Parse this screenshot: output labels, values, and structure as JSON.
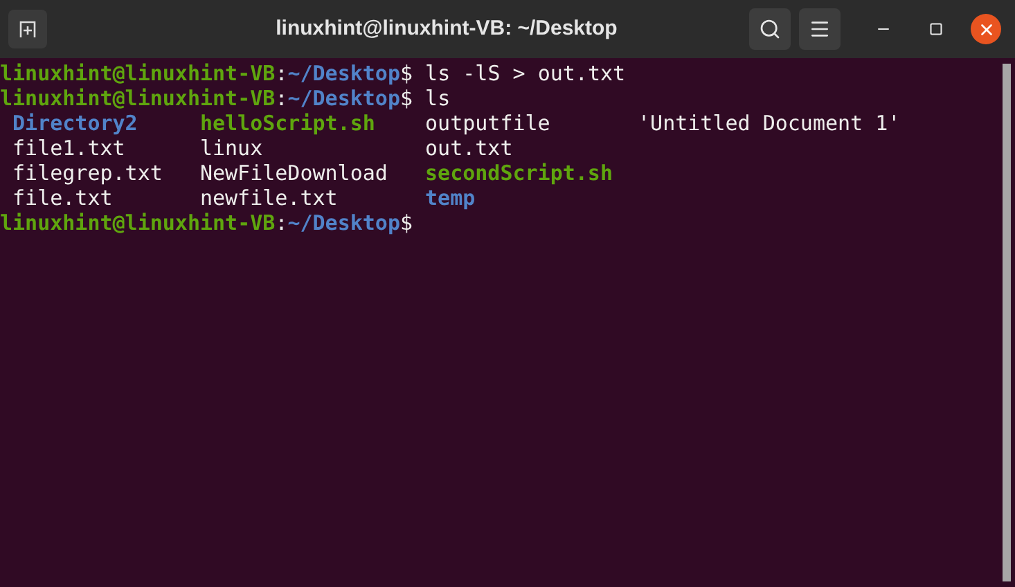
{
  "window": {
    "title": "linuxhint@linuxhint-VB: ~/Desktop"
  },
  "terminal": {
    "lines": [
      {
        "kind": "prompt",
        "user": "linuxhint@linuxhint-VB",
        "separator": ":",
        "path": "~/Desktop",
        "symbol": "$",
        "command": "ls -lS > out.txt"
      },
      {
        "kind": "prompt",
        "user": "linuxhint@linuxhint-VB",
        "separator": ":",
        "path": "~/Desktop",
        "symbol": "$",
        "command": "ls"
      },
      {
        "kind": "listing",
        "entries": [
          {
            "name": "Directory2",
            "kind": "directory"
          },
          {
            "name": "helloScript.sh",
            "kind": "executable"
          },
          {
            "name": "outputfile",
            "kind": "file"
          },
          {
            "name": "'Untitled Document 1'",
            "kind": "file"
          }
        ]
      },
      {
        "kind": "listing",
        "entries": [
          {
            "name": "file1.txt",
            "kind": "file"
          },
          {
            "name": "linux",
            "kind": "file"
          },
          {
            "name": "out.txt",
            "kind": "file"
          }
        ]
      },
      {
        "kind": "listing",
        "entries": [
          {
            "name": "filegrep.txt",
            "kind": "file"
          },
          {
            "name": "NewFileDownload",
            "kind": "file"
          },
          {
            "name": "secondScript.sh",
            "kind": "executable"
          }
        ]
      },
      {
        "kind": "listing",
        "entries": [
          {
            "name": "file.txt",
            "kind": "file"
          },
          {
            "name": "newfile.txt",
            "kind": "file"
          },
          {
            "name": "temp",
            "kind": "directory"
          }
        ]
      },
      {
        "kind": "prompt",
        "user": "linuxhint@linuxhint-VB",
        "separator": ":",
        "path": "~/Desktop",
        "symbol": "$"
      }
    ]
  }
}
